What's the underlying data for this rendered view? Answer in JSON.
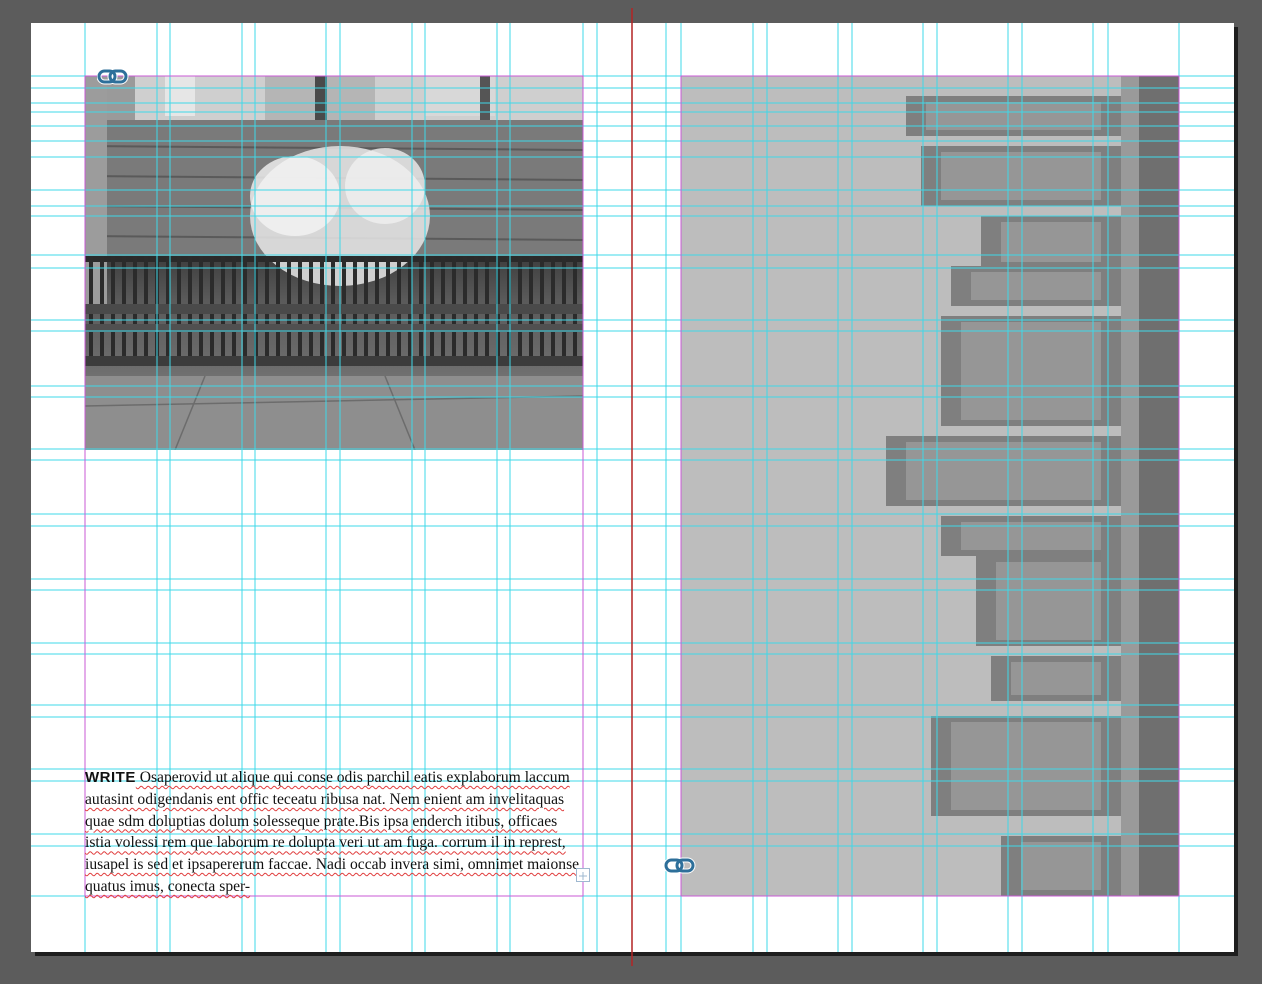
{
  "document": {
    "spread": "facing-pages",
    "colors": {
      "pasteboard": "#5c5c5c",
      "page": "#ffffff",
      "guide": "#3fd8e8",
      "margin": "#c95ad6",
      "spine": "#b32424",
      "spellcheck": "#e03c3c",
      "link_badge": "#2d6f9a"
    }
  },
  "left_page": {
    "image_frame": {
      "content": "grayscale photo of park bench, iron fence and flowering tree",
      "link_badge_icon": "chain-link-icon"
    },
    "text_frame": {
      "lead_in": "WRITE",
      "body": " Osaperovid ut alique qui conse odis parchil eatis explaborum laccum autasint odigendanis ent offic teceatu ribusa nat. Nem enient am invelitaquas quae sdm doluptias dolum solesseque prate.Bis ipsa enderch itibus, officaes istia volessi rem que laborum re dolupta veri ut am fuga. corrum il in represt, iusapel is sed et ipsapererum faccae. Nadi occab invera simi, omnimet maionse quatus imus, conecta sper-",
      "overset_icon": "overset-text-icon"
    }
  },
  "right_page": {
    "image_frame": {
      "content": "grayscale photo of city skyline rotated 90 degrees",
      "link_badge_icon": "chain-link-icon"
    }
  }
}
